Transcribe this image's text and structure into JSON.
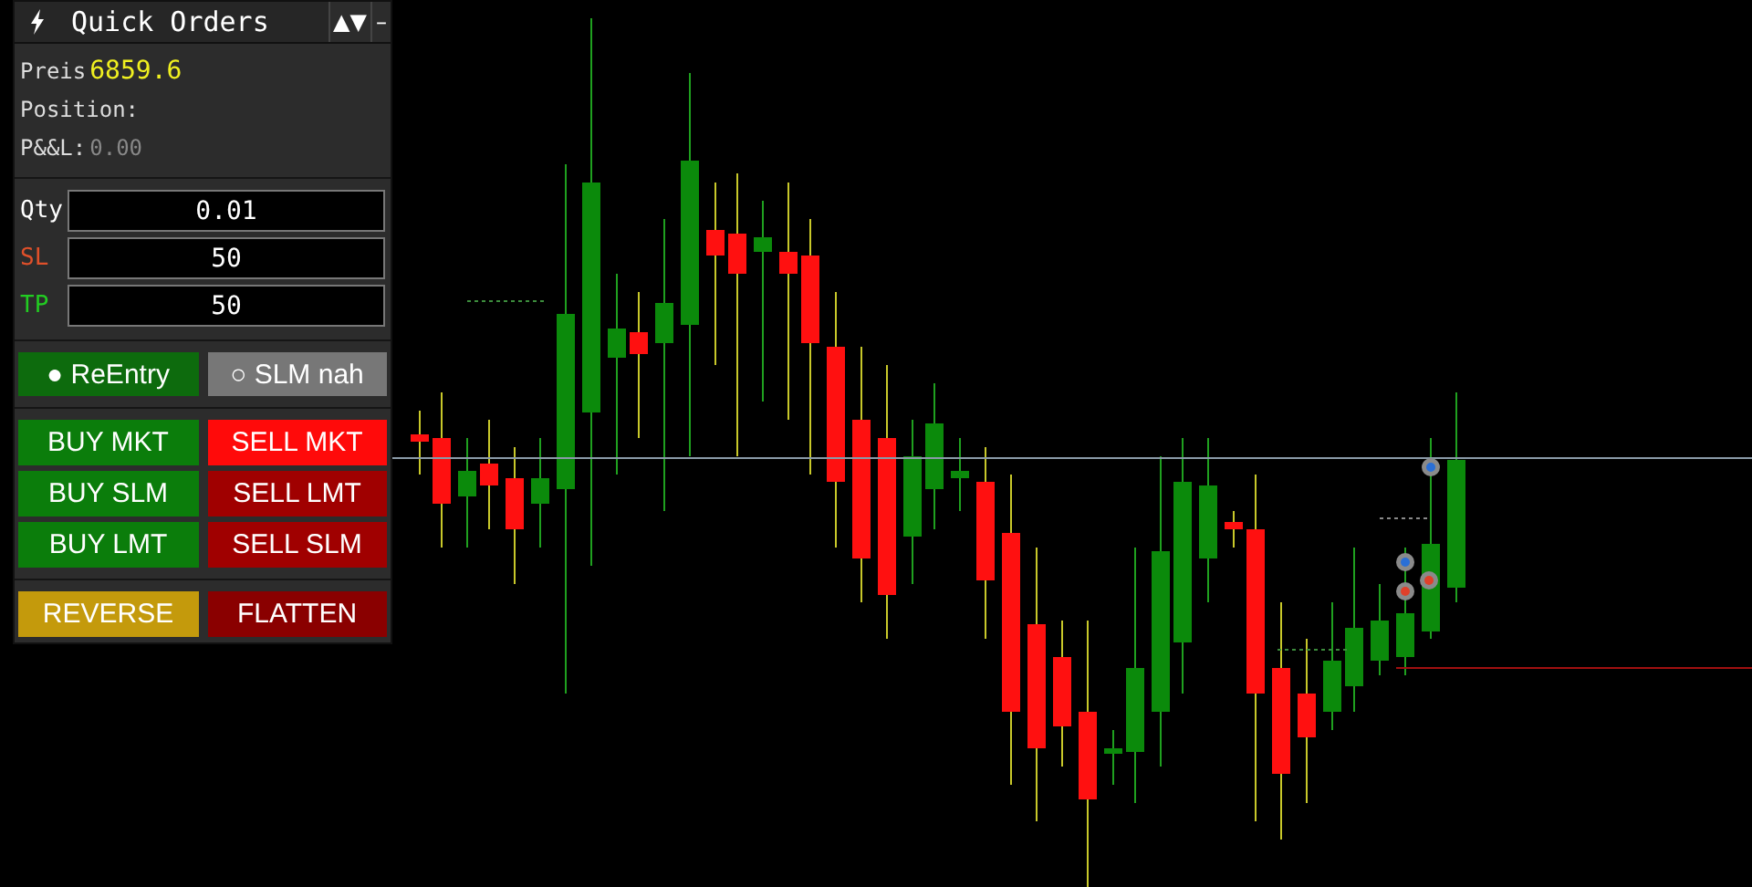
{
  "panel": {
    "title": "Quick Orders",
    "title_controls": [
      "▲▼",
      "–"
    ],
    "info": [
      {
        "label": "Preis",
        "value": "6859.6",
        "kind": "price"
      },
      {
        "label": "Position:"
      },
      {
        "label": "P&&L:",
        "value": "0.00",
        "kind": "muted"
      }
    ],
    "fields": [
      {
        "label": "Qty",
        "value": "0.01",
        "color": "#ffffff"
      },
      {
        "label": "SL",
        "value": "50",
        "color": "#e0502a"
      },
      {
        "label": "TP",
        "value": "50",
        "color": "#22cc22"
      }
    ],
    "toggles": [
      {
        "label": "● ReEntry",
        "on": true
      },
      {
        "label": "○ SLM nah",
        "on": false
      }
    ],
    "order_buttons": [
      {
        "label": "BUY MKT",
        "color": "#0b7d0b"
      },
      {
        "label": "SELL MKT",
        "color": "#ff0a0a"
      },
      {
        "label": "BUY SLM",
        "color": "#0b7d0b"
      },
      {
        "label": "SELL LMT",
        "color": "#a00000"
      },
      {
        "label": "BUY LMT",
        "color": "#0b7d0b"
      },
      {
        "label": "SELL SLM",
        "color": "#a00000"
      }
    ],
    "action_buttons": [
      {
        "label": "REVERSE",
        "color": "#c49a0c"
      },
      {
        "label": "FLATTEN",
        "color": "#8a0000"
      }
    ]
  }
}
